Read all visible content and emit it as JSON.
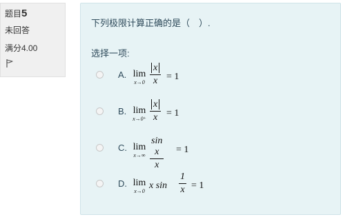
{
  "info": {
    "question_label": "题目",
    "question_number": "5",
    "state": "未回答",
    "grade": "满分4.00"
  },
  "question": {
    "text": "下列极限计算正确的是（　）.",
    "prompt": "选择一项:"
  },
  "options": [
    {
      "label": "A.",
      "sub": "x→0",
      "num": "|x|",
      "den": "x",
      "rhs": "= 1"
    },
    {
      "label": "B.",
      "sub": "x→0⁺",
      "num": "|x|",
      "den": "x",
      "rhs": "= 1"
    },
    {
      "label": "C.",
      "sub": "x→∞",
      "num": "sin x",
      "den": "x",
      "rhs": "= 1"
    },
    {
      "label": "D.",
      "sub": "x→0",
      "pre": "x sin",
      "num": "1",
      "den": "x",
      "rhs": "= 1"
    }
  ],
  "math": {
    "lim": "lim"
  },
  "icons": {
    "flag": "flag-icon",
    "radio": "radio-button"
  }
}
